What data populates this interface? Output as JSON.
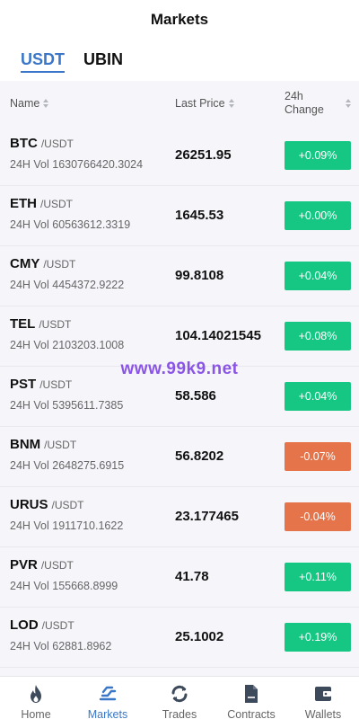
{
  "header": {
    "title": "Markets"
  },
  "quote_tabs": [
    {
      "label": "USDT",
      "active": true
    },
    {
      "label": "UBIN",
      "active": false
    }
  ],
  "table_header": {
    "name": "Name",
    "last_price": "Last Price",
    "change_line1": "24h",
    "change_line2": "Change"
  },
  "markets": [
    {
      "base": "BTC",
      "quote": "/USDT",
      "volume": "24H Vol 1630766420.3024",
      "price": "26251.95",
      "change": "+0.09%",
      "direction": "up"
    },
    {
      "base": "ETH",
      "quote": "/USDT",
      "volume": "24H Vol 60563612.3319",
      "price": "1645.53",
      "change": "+0.00%",
      "direction": "up"
    },
    {
      "base": "CMY",
      "quote": "/USDT",
      "volume": "24H Vol 4454372.9222",
      "price": "99.8108",
      "change": "+0.04%",
      "direction": "up"
    },
    {
      "base": "TEL",
      "quote": "/USDT",
      "volume": "24H Vol 2103203.1008",
      "price": "104.14021545",
      "change": "+0.08%",
      "direction": "up"
    },
    {
      "base": "PST",
      "quote": "/USDT",
      "volume": "24H Vol 5395611.7385",
      "price": "58.586",
      "change": "+0.04%",
      "direction": "up"
    },
    {
      "base": "BNM",
      "quote": "/USDT",
      "volume": "24H Vol 2648275.6915",
      "price": "56.8202",
      "change": "-0.07%",
      "direction": "down"
    },
    {
      "base": "URUS",
      "quote": "/USDT",
      "volume": "24H Vol 1911710.1622",
      "price": "23.177465",
      "change": "-0.04%",
      "direction": "down"
    },
    {
      "base": "PVR",
      "quote": "/USDT",
      "volume": "24H Vol 155668.8999",
      "price": "41.78",
      "change": "+0.11%",
      "direction": "up"
    },
    {
      "base": "LOD",
      "quote": "/USDT",
      "volume": "24H Vol 62881.8962",
      "price": "25.1002",
      "change": "+0.19%",
      "direction": "up"
    }
  ],
  "watermark": "www.99k9.net",
  "nav": [
    {
      "label": "Home",
      "icon": "flame-icon",
      "active": false
    },
    {
      "label": "Markets",
      "icon": "markets-icon",
      "active": true
    },
    {
      "label": "Trades",
      "icon": "refresh-icon",
      "active": false
    },
    {
      "label": "Contracts",
      "icon": "document-icon",
      "active": false
    },
    {
      "label": "Wallets",
      "icon": "wallet-icon",
      "active": false
    }
  ],
  "colors": {
    "accent": "#3a77c8",
    "up": "#16c784",
    "down": "#e5744b",
    "nav_icon": "#3d4a5c"
  }
}
